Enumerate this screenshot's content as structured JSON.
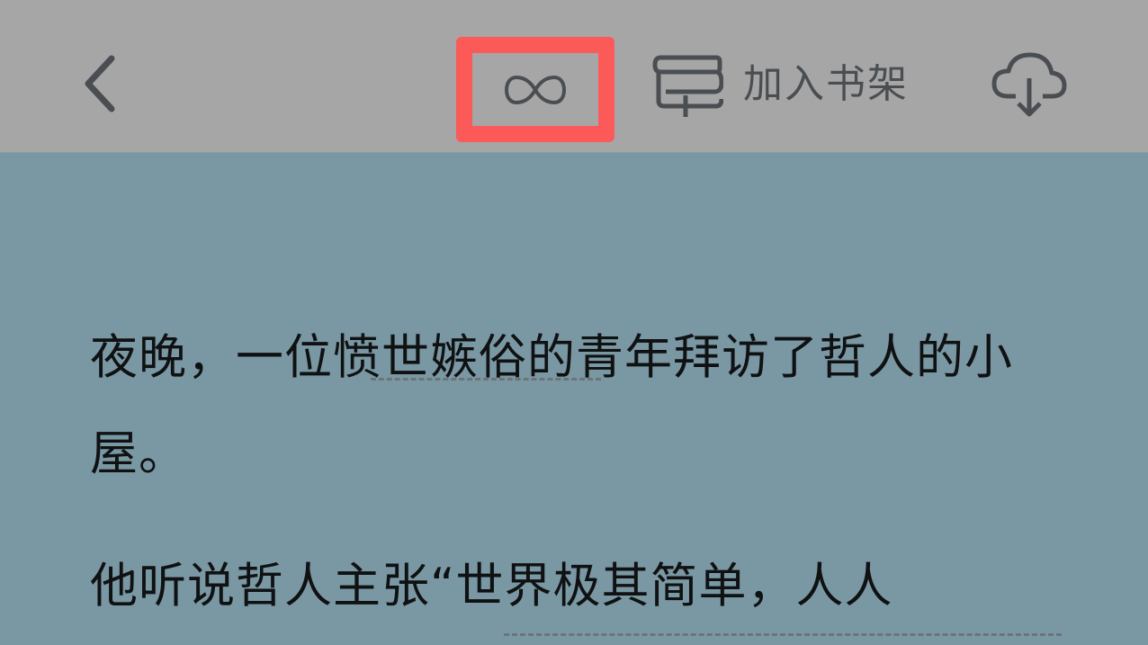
{
  "toolbar": {
    "back_icon": "chevron-left-icon",
    "infinity_icon": "infinity-icon",
    "add_shelf_icon": "bookshelf-add-icon",
    "add_shelf_label": "加入书架",
    "download_icon": "cloud-download-icon",
    "highlight_color": "#fc5a58"
  },
  "article": {
    "paragraphs": [
      "夜晚，一位愤世嫉俗的青年拜访了哲人的小屋。",
      "他听说哲人主张“世界极其简单，人人"
    ],
    "underlined": [
      "愤世嫉俗",
      "世界极其简单，人人"
    ]
  },
  "colors": {
    "toolbar_bg": "#a6a6a6",
    "page_bg": "#7a98a3",
    "icon": "#4a4e52",
    "text": "#0f1112"
  }
}
